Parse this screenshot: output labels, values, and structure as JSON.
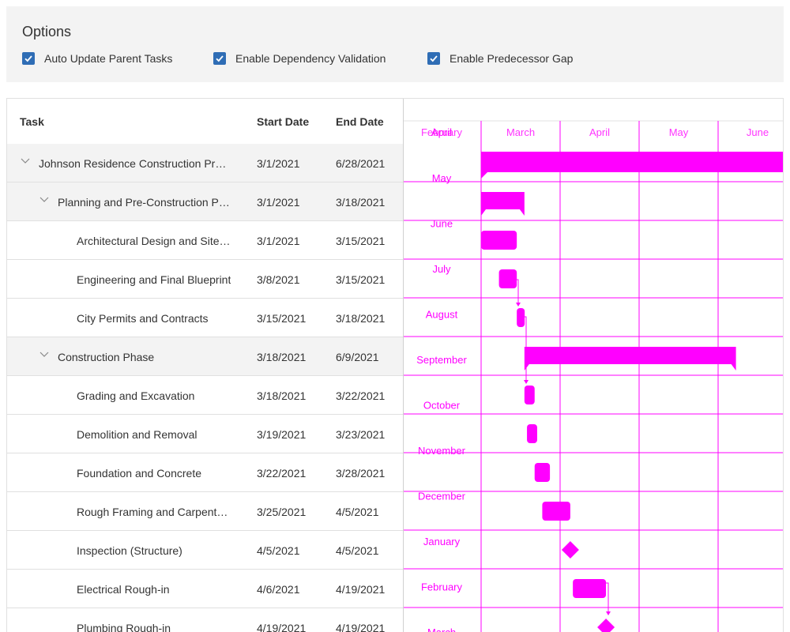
{
  "options": {
    "title": "Options",
    "checkboxes": [
      {
        "label": "Auto Update Parent Tasks",
        "checked": true
      },
      {
        "label": "Enable Dependency Validation",
        "checked": true
      },
      {
        "label": "Enable Predecessor Gap",
        "checked": true
      }
    ]
  },
  "grid": {
    "columns": {
      "task": "Task",
      "start": "Start Date",
      "end": "End Date"
    },
    "rows": [
      {
        "level": 0,
        "parent": true,
        "name": "Johnson Residence Construction Pr…",
        "start": "3/1/2021",
        "end": "6/28/2021"
      },
      {
        "level": 1,
        "parent": true,
        "name": "Planning and Pre-Construction P…",
        "start": "3/1/2021",
        "end": "3/18/2021"
      },
      {
        "level": 2,
        "parent": false,
        "name": "Architectural Design and Site…",
        "start": "3/1/2021",
        "end": "3/15/2021"
      },
      {
        "level": 2,
        "parent": false,
        "name": "Engineering and Final Blueprint",
        "start": "3/8/2021",
        "end": "3/15/2021"
      },
      {
        "level": 2,
        "parent": false,
        "name": "City Permits and Contracts",
        "start": "3/15/2021",
        "end": "3/18/2021"
      },
      {
        "level": 1,
        "parent": true,
        "name": "Construction Phase",
        "start": "3/18/2021",
        "end": "6/9/2021"
      },
      {
        "level": 2,
        "parent": false,
        "name": "Grading and Excavation",
        "start": "3/18/2021",
        "end": "3/22/2021"
      },
      {
        "level": 2,
        "parent": false,
        "name": "Demolition and Removal",
        "start": "3/19/2021",
        "end": "3/23/2021"
      },
      {
        "level": 2,
        "parent": false,
        "name": "Foundation and Concrete",
        "start": "3/22/2021",
        "end": "3/28/2021"
      },
      {
        "level": 2,
        "parent": false,
        "name": "Rough Framing and Carpent…",
        "start": "3/25/2021",
        "end": "4/5/2021"
      },
      {
        "level": 2,
        "parent": false,
        "name": "Inspection (Structure)",
        "start": "4/5/2021",
        "end": "4/5/2021"
      },
      {
        "level": 2,
        "parent": false,
        "name": "Electrical Rough-in",
        "start": "4/6/2021",
        "end": "4/19/2021"
      },
      {
        "level": 2,
        "parent": false,
        "name": "Plumbing Rough-in",
        "start": "4/19/2021",
        "end": "4/19/2021"
      }
    ]
  },
  "timeline": {
    "accent_color": "#ff00ff",
    "header_months": [
      "February",
      "March",
      "April",
      "May",
      "June"
    ],
    "overlap_label": "April",
    "stray_month_labels": [
      "May",
      "June",
      "July",
      "August",
      "September",
      "October",
      "November",
      "December",
      "January",
      "February",
      "March"
    ]
  }
}
